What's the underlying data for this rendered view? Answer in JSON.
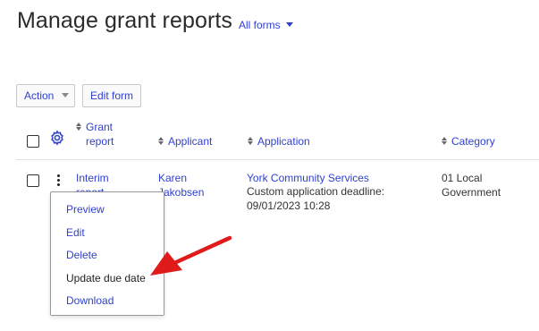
{
  "page": {
    "title": "Manage grant reports",
    "form_filter": "All forms"
  },
  "toolbar": {
    "action_label": "Action",
    "edit_form_label": "Edit form"
  },
  "table": {
    "columns": [
      {
        "label": "Grant report"
      },
      {
        "label": "Applicant"
      },
      {
        "label": "Application"
      },
      {
        "label": "Category"
      }
    ],
    "rows": [
      {
        "grant_report": "Interim report",
        "applicant": "Karen Jakobsen",
        "application_name": "York Community Services",
        "application_deadline": "Custom application deadline: 09/01/2023 10:28",
        "category": "01 Local Government"
      }
    ]
  },
  "row_menu": {
    "items": [
      {
        "label": "Preview"
      },
      {
        "label": "Edit"
      },
      {
        "label": "Delete"
      },
      {
        "label": "Update due date"
      },
      {
        "label": "Download"
      }
    ]
  },
  "colors": {
    "link": "#2f3fcf",
    "annotation_arrow": "#e01b1b"
  }
}
